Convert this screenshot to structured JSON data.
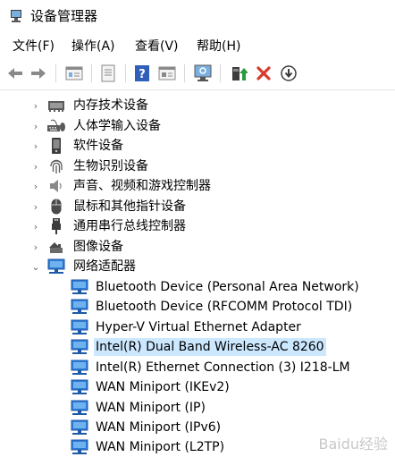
{
  "window": {
    "title": "设备管理器"
  },
  "menu": [
    {
      "label": "文件(F)"
    },
    {
      "label": "操作(A)"
    },
    {
      "label": "查看(V)"
    },
    {
      "label": "帮助(H)"
    }
  ],
  "toolbar": {
    "buttons": [
      "back-icon",
      "forward-icon",
      "properties-icon",
      "driver-icon",
      "help-icon",
      "view-icon",
      "scan-icon",
      "update-driver-icon",
      "uninstall-icon",
      "disable-icon"
    ]
  },
  "tree": {
    "categories": [
      {
        "label": "内存技术设备",
        "icon": "memory-icon",
        "expanded": false
      },
      {
        "label": "人体学输入设备",
        "icon": "hid-icon",
        "expanded": false
      },
      {
        "label": "软件设备",
        "icon": "software-icon",
        "expanded": false
      },
      {
        "label": "生物识别设备",
        "icon": "fingerprint-icon",
        "expanded": false
      },
      {
        "label": "声音、视频和游戏控制器",
        "icon": "speaker-icon",
        "expanded": false
      },
      {
        "label": "鼠标和其他指针设备",
        "icon": "mouse-icon",
        "expanded": false
      },
      {
        "label": "通用串行总线控制器",
        "icon": "usb-icon",
        "expanded": false
      },
      {
        "label": "图像设备",
        "icon": "camera-icon",
        "expanded": false
      },
      {
        "label": "网络适配器",
        "icon": "network-icon",
        "expanded": true
      }
    ],
    "network_devices": [
      {
        "label": "Bluetooth Device (Personal Area Network)",
        "selected": false
      },
      {
        "label": "Bluetooth Device (RFCOMM Protocol TDI)",
        "selected": false
      },
      {
        "label": "Hyper-V Virtual Ethernet Adapter",
        "selected": false
      },
      {
        "label": "Intel(R) Dual Band Wireless-AC 8260",
        "selected": true
      },
      {
        "label": "Intel(R) Ethernet Connection (3) I218-LM",
        "selected": false
      },
      {
        "label": "WAN Miniport (IKEv2)",
        "selected": false
      },
      {
        "label": "WAN Miniport (IP)",
        "selected": false
      },
      {
        "label": "WAN Miniport (IPv6)",
        "selected": false
      },
      {
        "label": "WAN Miniport (L2TP)",
        "selected": false
      }
    ]
  },
  "watermark": "Baidu经验",
  "colors": {
    "selection": "#cce8ff",
    "network_icon": "#2e7bd6",
    "uninstall_red": "#d83a2c",
    "update_green": "#2a9a3c"
  }
}
